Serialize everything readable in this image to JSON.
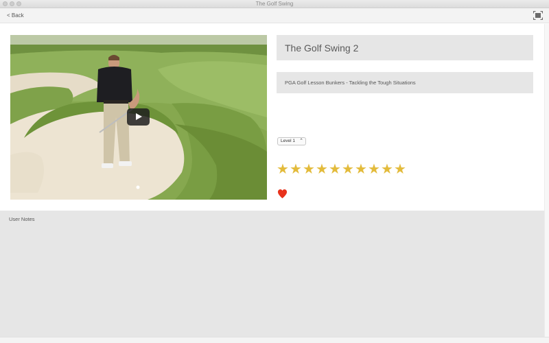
{
  "window": {
    "title": "The Golf Swing"
  },
  "toolbar": {
    "back_label": "< Back"
  },
  "lesson": {
    "title": "The Golf Swing 2",
    "subtitle": "PGA Golf Lesson Bunkers - Tackling the Tough Situations",
    "level": "Level 1",
    "rating": 10,
    "rating_max": 10,
    "favorite": true
  },
  "colors": {
    "star": "#e3bb3b",
    "heart": "#e8321c",
    "panel": "#e6e6e6"
  },
  "icons": {
    "fullscreen": "fullscreen-icon",
    "play": "play-icon",
    "heart": "heart-icon",
    "star": "star-icon"
  },
  "notes": {
    "label": "User Notes"
  }
}
